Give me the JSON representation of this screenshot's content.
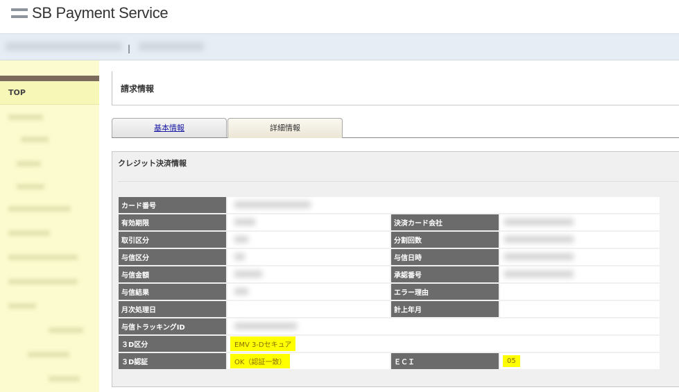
{
  "header": {
    "brand": "SB Payment Service",
    "separator": "|"
  },
  "sidebar": {
    "top_label": "TOP"
  },
  "page": {
    "title": "請求情報"
  },
  "tabs": [
    {
      "label": "基本情報"
    },
    {
      "label": "詳細情報"
    }
  ],
  "panel": {
    "title": "クレジット決済情報",
    "rows": {
      "card_number": {
        "label": "カード番号"
      },
      "expiry": {
        "label": "有効期限"
      },
      "card_company": {
        "label": "決済カード会社"
      },
      "transaction_type": {
        "label": "取引区分"
      },
      "installments": {
        "label": "分割回数"
      },
      "auth_type": {
        "label": "与信区分"
      },
      "auth_datetime": {
        "label": "与信日時"
      },
      "auth_amount": {
        "label": "与信金額"
      },
      "approval_number": {
        "label": "承認番号"
      },
      "auth_result": {
        "label": "与信結果"
      },
      "error_reason": {
        "label": "エラー理由"
      },
      "monthly_process_date": {
        "label": "月次処理日"
      },
      "posting_month": {
        "label": "計上年月"
      },
      "auth_tracking_id": {
        "label": "与信トラッキングID"
      },
      "three_d_type": {
        "label": "３D区分",
        "value": "EMV 3-Dセキュア"
      },
      "three_d_auth": {
        "label": "３D認証",
        "value": "OK（認証一致）"
      },
      "eci": {
        "label": "ＥＣＩ",
        "value": "05"
      }
    }
  },
  "colors": {
    "highlight": "#ffff00",
    "label_bg": "#6b6b6b",
    "sidebar_bg": "#fbfbcf",
    "link": "#1a1aa6"
  }
}
